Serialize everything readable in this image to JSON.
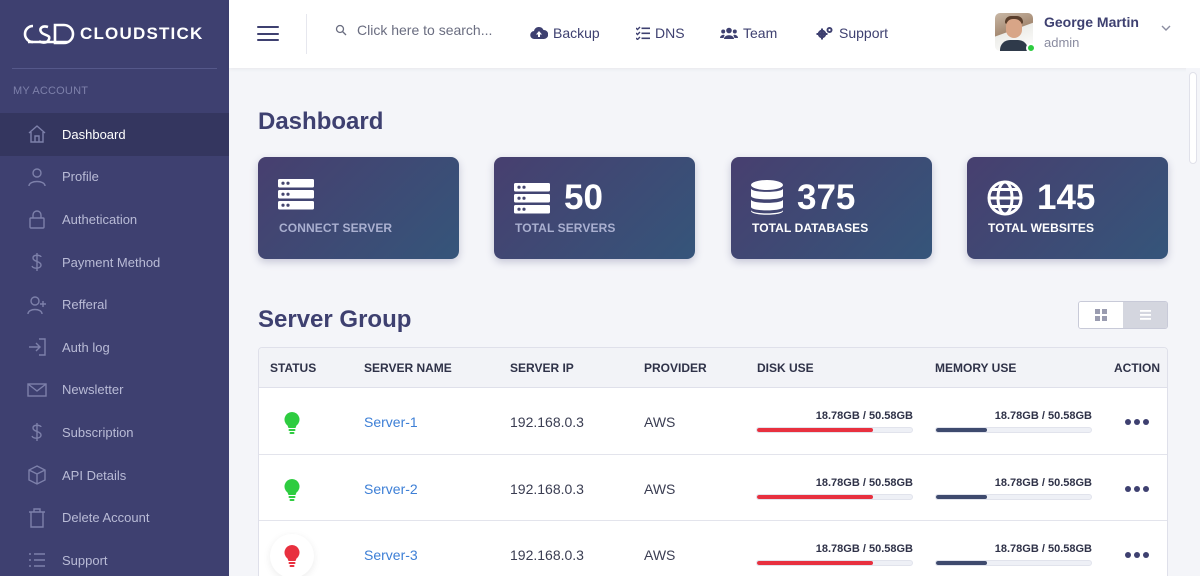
{
  "brand": {
    "name": "CLOUDSTICK"
  },
  "sidebar": {
    "heading": "MY ACCOUNT",
    "items": [
      {
        "label": "Dashboard",
        "icon": "home-icon",
        "active": true
      },
      {
        "label": "Profile",
        "icon": "user-icon"
      },
      {
        "label": "Authetication",
        "icon": "lock-icon"
      },
      {
        "label": "Payment Method",
        "icon": "dollar-icon"
      },
      {
        "label": "Refferal",
        "icon": "user-plus-icon"
      },
      {
        "label": "Auth log",
        "icon": "sign-in-icon"
      },
      {
        "label": "Newsletter",
        "icon": "envelope-icon"
      },
      {
        "label": "Subscription",
        "icon": "dollar-icon"
      },
      {
        "label": "API Details",
        "icon": "cube-icon"
      },
      {
        "label": "Delete Account",
        "icon": "trash-icon"
      },
      {
        "label": "Support",
        "icon": "list-icon"
      }
    ]
  },
  "topbar": {
    "search_placeholder": "Click here to search...",
    "links": [
      {
        "label": "Backup",
        "icon": "cloud-upload-icon"
      },
      {
        "label": "DNS",
        "icon": "checklist-icon"
      },
      {
        "label": "Team",
        "icon": "users-icon"
      },
      {
        "label": "Support",
        "icon": "gears-icon"
      }
    ],
    "user": {
      "name": "George Martin",
      "role": "admin",
      "status_color": "#2ecc40"
    }
  },
  "main": {
    "title": "Dashboard",
    "stats": [
      {
        "value": "",
        "label": "CONNECT SERVER",
        "icon": "server-icon"
      },
      {
        "value": "50",
        "label": "TOTAL SERVERS",
        "icon": "server-icon"
      },
      {
        "value": "375",
        "label": "TOTAL DATABASES",
        "icon": "database-icon"
      },
      {
        "value": "145",
        "label": "TOTAL WEBSITES",
        "icon": "globe-icon"
      }
    ],
    "server_group": {
      "title": "Server Group",
      "columns": [
        "STATUS",
        "SERVER NAME",
        "SERVER IP",
        "PROVIDER",
        "DISK USE",
        "MEMORY USE",
        "ACTION"
      ],
      "rows": [
        {
          "status": "online",
          "status_color": "#2ecc40",
          "name": "Server-1",
          "ip": "192.168.0.3",
          "provider": "AWS",
          "disk": "18.78GB / 50.58GB",
          "memory": "18.78GB / 50.58GB",
          "disk_fraction": 0.75,
          "memory_fraction": 0.33
        },
        {
          "status": "online",
          "status_color": "#2ecc40",
          "name": "Server-2",
          "ip": "192.168.0.3",
          "provider": "AWS",
          "disk": "18.78GB / 50.58GB",
          "memory": "18.78GB / 50.58GB",
          "disk_fraction": 0.75,
          "memory_fraction": 0.33
        },
        {
          "status": "offline",
          "status_color": "#e8303f",
          "name": "Server-3",
          "ip": "192.168.0.3",
          "provider": "AWS",
          "disk": "18.78GB / 50.58GB",
          "memory": "18.78GB / 50.58GB",
          "disk_fraction": 0.75,
          "memory_fraction": 0.33
        }
      ]
    }
  },
  "colors": {
    "sidebar_bg": "#3e4070",
    "accent": "#3e4070",
    "disk_bar": "#e8303f",
    "memory_bar": "#3e4a6e",
    "link": "#3d7fd6"
  }
}
